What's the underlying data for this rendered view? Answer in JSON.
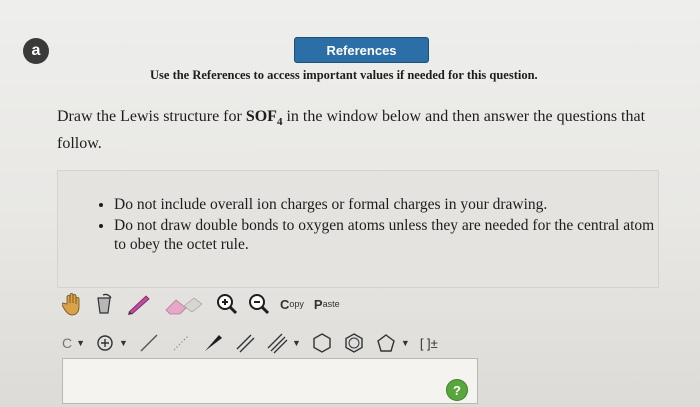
{
  "badge": {
    "letter": "a"
  },
  "references": {
    "button_label": "References"
  },
  "reference_note": "Use the References to access important values if needed for this question.",
  "question": {
    "prefix": "Draw the Lewis structure for ",
    "formula_base": "SOF",
    "formula_sub": "4",
    "suffix": " in the window below and then answer the questions that follow."
  },
  "instructions": [
    "Do not include overall ion charges or formal charges in your drawing.",
    "Do not draw double bonds to oxygen atoms unless they are needed for the central atom to obey the octet rule."
  ],
  "toolbar": {
    "copy_top": "C",
    "copy_bottom": "opy",
    "paste_top": "P",
    "paste_bottom": "aste",
    "bracket_label": "[ ]±",
    "element_label": "C"
  },
  "help": {
    "label": "?"
  },
  "colors": {
    "accent": "#2b6fa6",
    "help": "#5aa63e"
  },
  "icons": [
    "hand-icon",
    "bucket-icon",
    "pencil-icon",
    "eraser-icon",
    "zoom-in-icon",
    "zoom-out-icon",
    "plus-circle-icon",
    "single-bond-icon",
    "wedge-bond-icon",
    "double-bond-icon",
    "triple-bond-icon",
    "ring-icon",
    "cyclopentane-icon",
    "cyclobutane-icon",
    "help-icon"
  ]
}
